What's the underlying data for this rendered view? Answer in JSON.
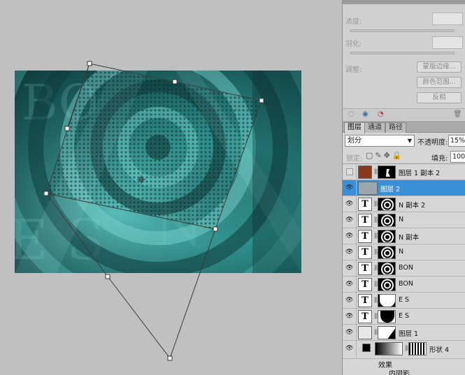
{
  "mask_panel": {
    "density_label": "浓度:",
    "feather_label": "羽化:",
    "refine_label": "调整:",
    "buttons": [
      "蒙版边缘...",
      "颜色范围...",
      "反相"
    ]
  },
  "layers_panel": {
    "tabs": [
      "图层",
      "通道",
      "路径"
    ],
    "blend_mode": "划分",
    "opacity_label": "不透明度:",
    "opacity_value": "15%",
    "lock_label": "锁定:",
    "fill_label": "填充:",
    "fill_value": "100%",
    "layers": [
      {
        "name": "图层 1 副本 2",
        "type": "image",
        "visible": false,
        "selected": false
      },
      {
        "name": "图层 2",
        "type": "image",
        "visible": true,
        "selected": true
      },
      {
        "name": "N 副本 2",
        "type": "text",
        "visible": true,
        "selected": false
      },
      {
        "name": "N",
        "type": "text",
        "visible": true,
        "selected": false
      },
      {
        "name": "N 副本",
        "type": "text",
        "visible": true,
        "selected": false
      },
      {
        "name": "N",
        "type": "text",
        "visible": true,
        "selected": false
      },
      {
        "name": "BON",
        "type": "text",
        "visible": true,
        "selected": false
      },
      {
        "name": "BON",
        "type": "text",
        "visible": true,
        "selected": false
      },
      {
        "name": "E S",
        "type": "text",
        "visible": true,
        "selected": false
      },
      {
        "name": "E S",
        "type": "text",
        "visible": true,
        "selected": false
      },
      {
        "name": "图层 1",
        "type": "image",
        "visible": true,
        "selected": false
      },
      {
        "name": "形状 4",
        "type": "shape",
        "visible": true,
        "selected": false
      }
    ],
    "effects_label": "效果",
    "inner_shadow_label": "内阴影"
  },
  "colors": {
    "selection": "#3a8fd9",
    "panel_bg": "#d6d6d6",
    "canvas_bg": "#c0c0c0",
    "art_teal": "#2f9995"
  },
  "icons": [
    "eye-icon",
    "link-icon",
    "lock-icon",
    "brush-icon",
    "move-icon",
    "trash-icon",
    "dropdown-arrow-icon"
  ]
}
